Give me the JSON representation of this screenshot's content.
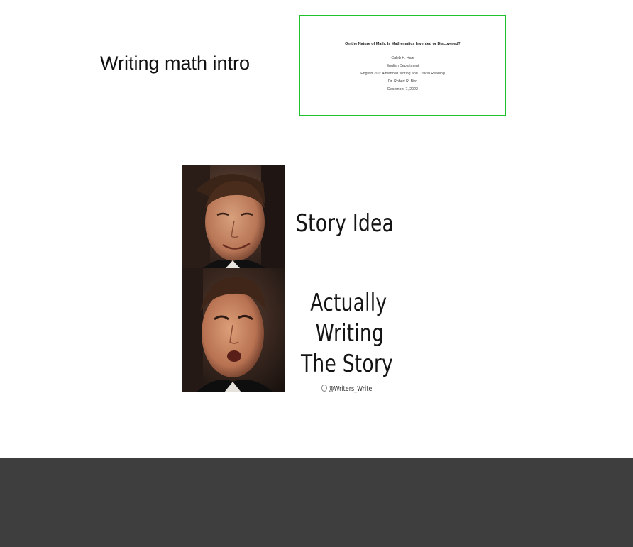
{
  "slide": {
    "heading": "Writing math intro",
    "document_thumbnail": {
      "title": "On the Nature of Math: Is Mathematics Invented or Discovered?",
      "lines": [
        "Caleb H. Hale",
        "English Department",
        "English 201: Advanced Writing and Critical Reading",
        "Dr. Robert R. Bird",
        "December 7, 2022"
      ],
      "border_color": "#22c02a"
    },
    "meme": {
      "caption_top": "Story Idea",
      "caption_bottom": [
        "Actually",
        "Writing",
        "The Story"
      ],
      "watermark": "@Writers_Write"
    }
  },
  "colors": {
    "bottom_bar": "#3e3e3e",
    "background": "#ffffff"
  }
}
